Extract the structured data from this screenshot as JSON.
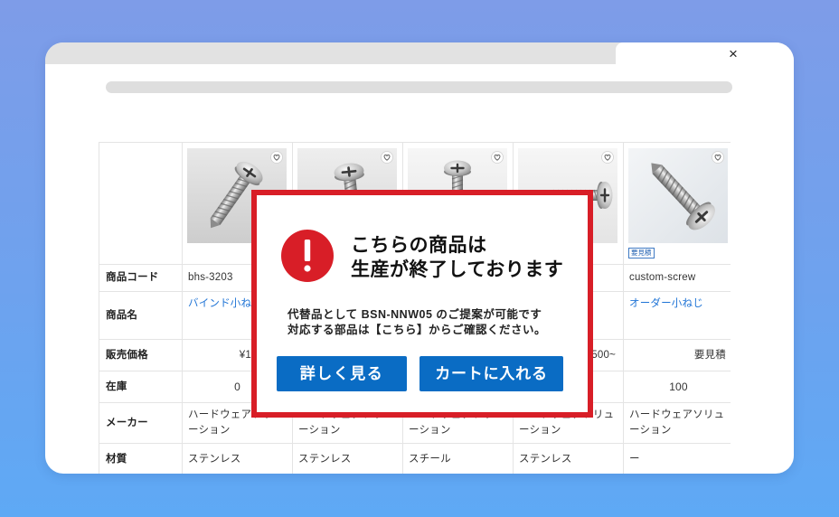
{
  "window": {
    "close_label": "×"
  },
  "table": {
    "labels": {
      "code": "商品コード",
      "name": "商品名",
      "price": "販売価格",
      "stock": "在庫",
      "maker": "メーカー",
      "material": "材質"
    },
    "products": [
      {
        "code": "bhs-3203",
        "name": "バインド小ね",
        "price": "¥1",
        "stock": "0",
        "maker": "ハードウェアソリューション",
        "material": "ステンレス"
      },
      {
        "code": "",
        "name": "",
        "price": "",
        "stock": "",
        "maker": "ハードウェアソリューション",
        "material": "ステンレス"
      },
      {
        "code": "",
        "name": "",
        "price": "",
        "stock": "",
        "maker": "ハードウェアソリューション",
        "material": "スチール"
      },
      {
        "code": "",
        "name": "",
        "price": "500~",
        "stock": "",
        "maker": "ハードウェアソリューション",
        "material": "ステンレス"
      },
      {
        "code": "custom-screw",
        "name": "オーダー小ねじ",
        "price": "要見積",
        "stock": "100",
        "maker": "ハードウェアソリューション",
        "material": "ー",
        "badge": "要見積"
      }
    ]
  },
  "modal": {
    "icon": "alert-icon",
    "title_line1": "こちらの商品は",
    "title_line2": "生産が終了しております",
    "body_line1": "代替品として BSN-NNW05 のご提案が可能です",
    "body_line2": "対応する部品は【こちら】からご確認ください。",
    "details_button": "詳しく見る",
    "cart_button": "カートに入れる"
  },
  "colors": {
    "alert_red": "#d81e27",
    "button_blue": "#0a6cc4",
    "link_blue": "#1f74d6",
    "badge_blue": "#2463b3"
  }
}
